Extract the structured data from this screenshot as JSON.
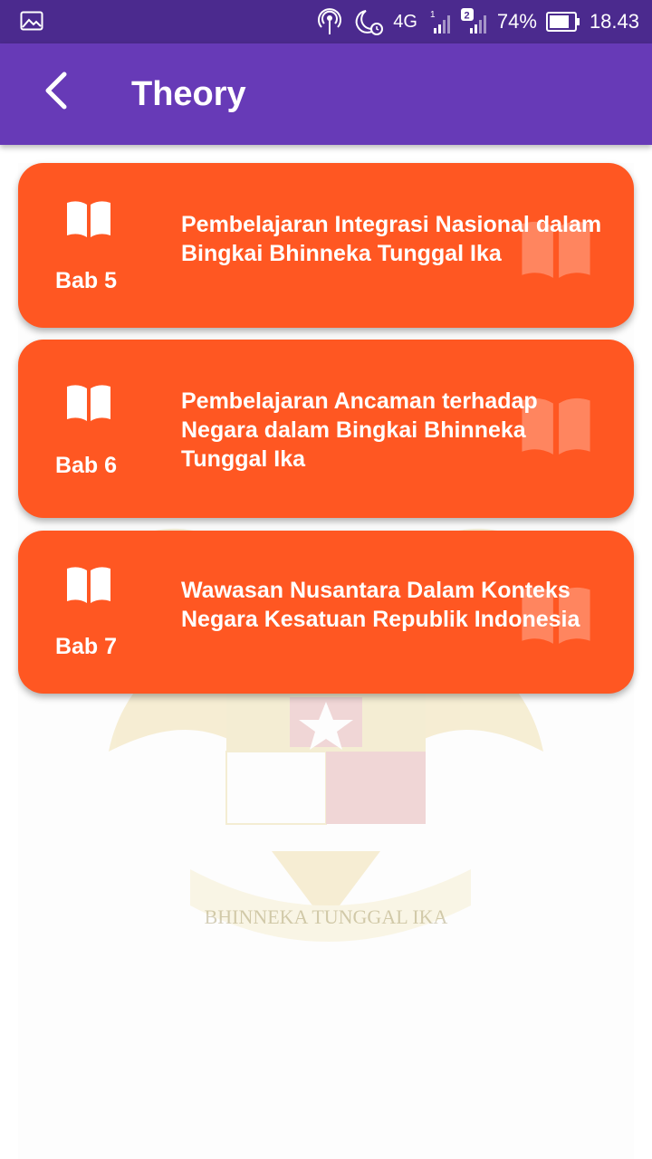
{
  "status_bar": {
    "network": "4G",
    "sim1": "1",
    "sim2": "2",
    "battery": "74%",
    "time": "18.43"
  },
  "app_bar": {
    "title": "Theory",
    "back_icon": "arrow-back-icon"
  },
  "watermark": {
    "motto": "BHINNEKA TUNGGAL IKA"
  },
  "chapters": [
    {
      "label": "Bab 5",
      "title": "Pembelajaran Integrasi Nasional dalam Bingkai Bhinneka Tunggal Ika",
      "icon": "book-icon"
    },
    {
      "label": "Bab 6",
      "title": "Pembelajaran Ancaman terhadap Negara dalam Bingkai Bhinneka Tunggal Ika",
      "icon": "book-icon"
    },
    {
      "label": "Bab 7",
      "title": "Wawasan Nusantara Dalam Konteks Negara Kesatuan Republik Indonesia",
      "icon": "book-icon"
    }
  ],
  "colors": {
    "status_bar": "#4b2a8e",
    "app_bar": "#673ab7",
    "card": "#ff5722"
  }
}
